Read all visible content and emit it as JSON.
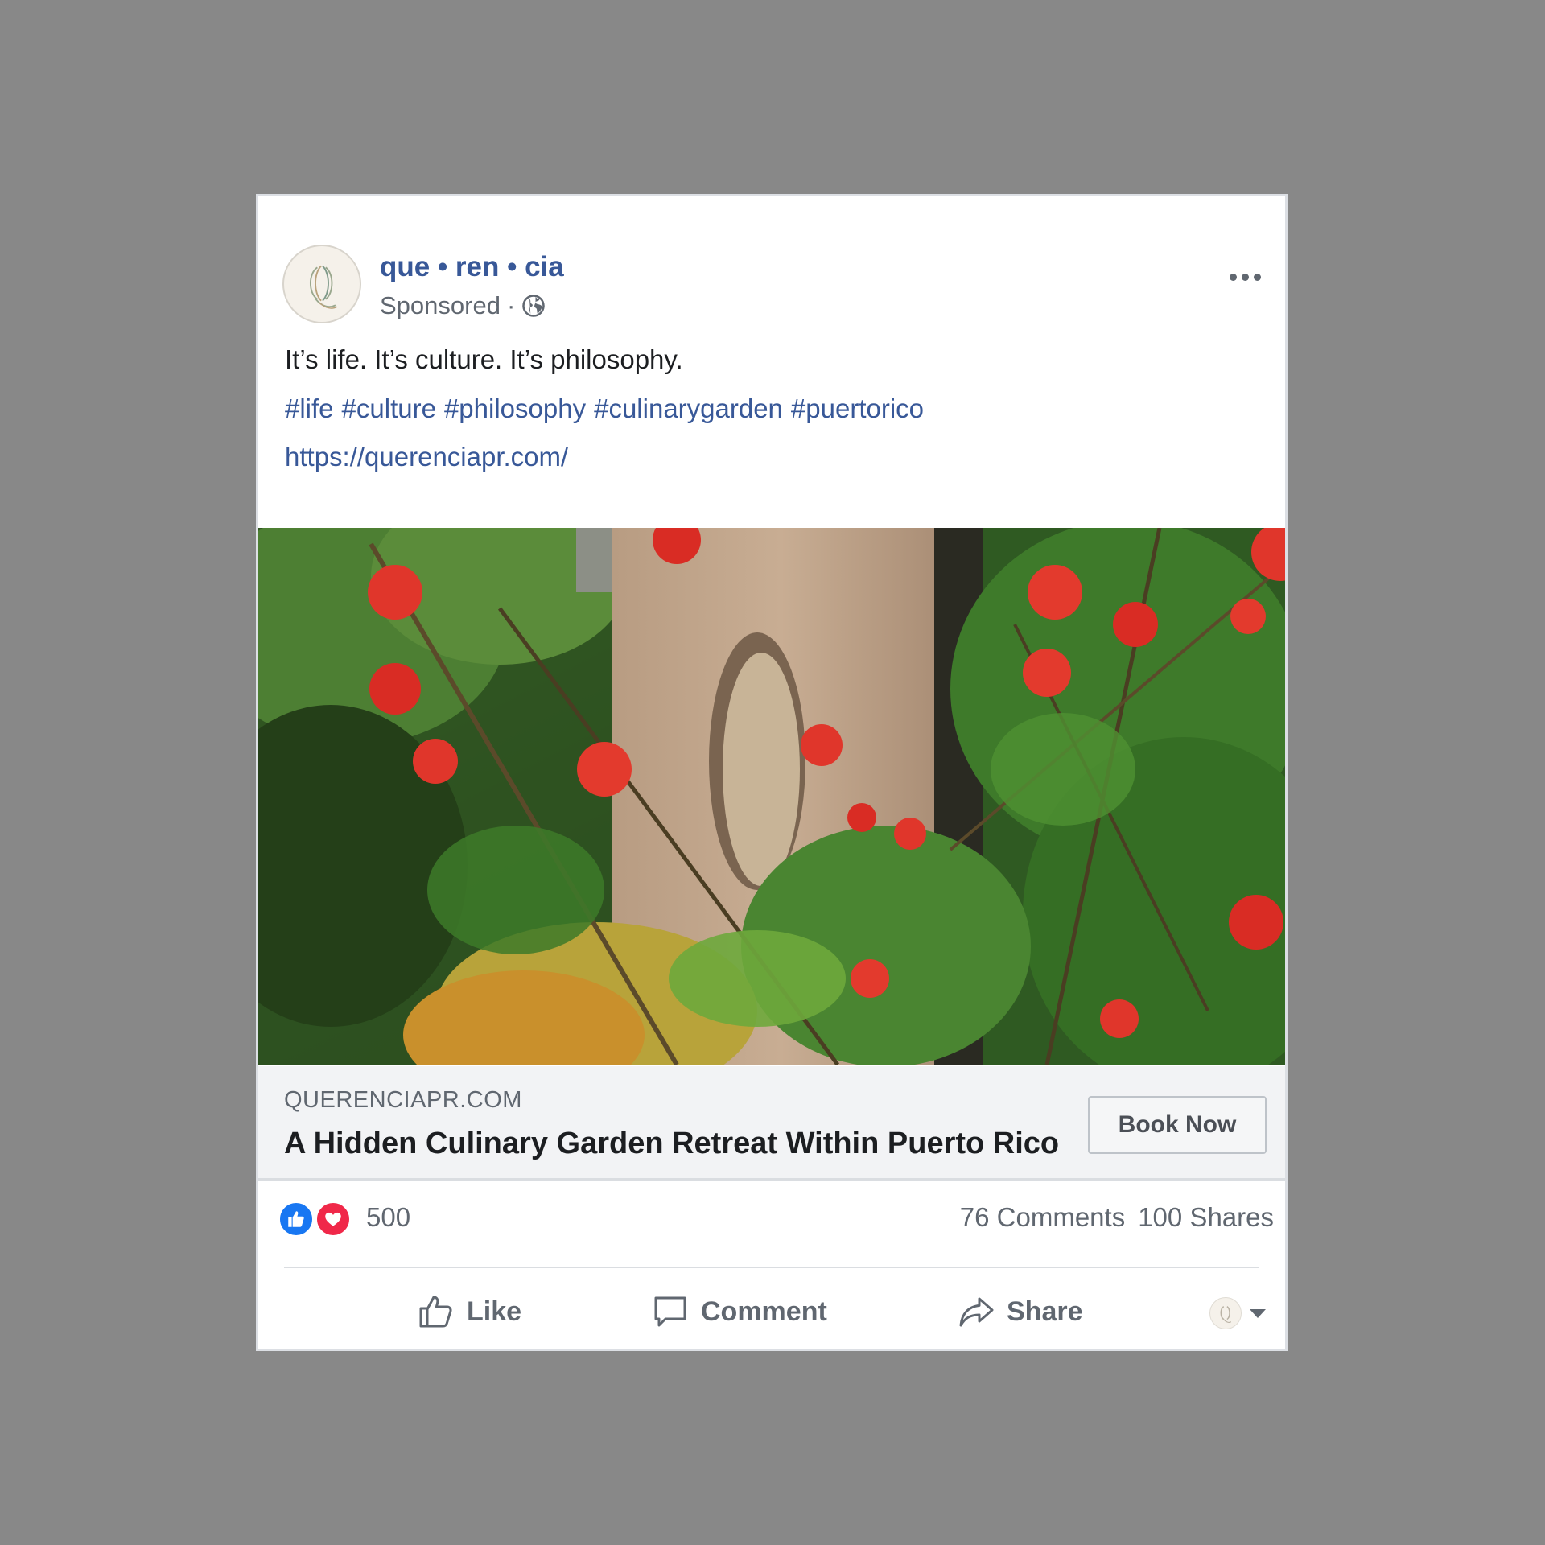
{
  "post": {
    "page_name": "que • ren • cia",
    "sponsored_label": "Sponsored",
    "meta_separator": "·",
    "audience_icon": "globe-icon",
    "more_icon": "more-options-icon",
    "caption": "It’s life. It’s culture. It’s philosophy.",
    "hashtags": [
      "#life",
      "#culture",
      "#philosophy",
      "#culinarygarden",
      "#puertorico"
    ],
    "url": "https://querenciapr.com/"
  },
  "link_preview": {
    "domain": "QUERENCIAPR.COM",
    "headline": "A Hidden Culinary Garden Retreat Within Puerto Rico",
    "cta_label": "Book Now"
  },
  "engagement": {
    "reaction_types": [
      "like",
      "love"
    ],
    "reaction_count": "500",
    "comments": "76 Comments",
    "shares": "100 Shares"
  },
  "actions": {
    "like": "Like",
    "comment": "Comment",
    "share": "Share"
  },
  "colors": {
    "link_blue": "#385898",
    "like_blue": "#1877f2",
    "love_red": "#f02849",
    "text_gray": "#606770",
    "text_dark": "#1c1e21",
    "background": "#888888"
  }
}
